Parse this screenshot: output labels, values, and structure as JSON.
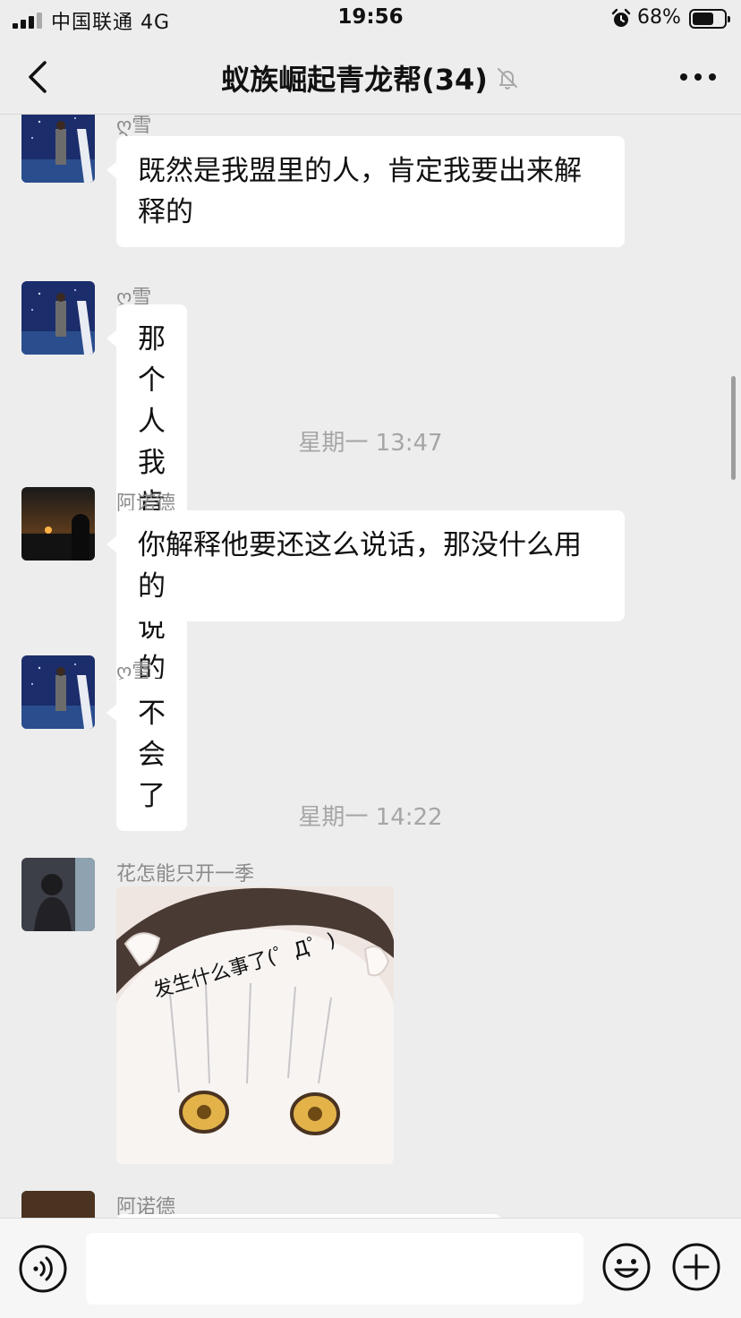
{
  "status_bar": {
    "carrier": "中国联通  4G",
    "time": "19:56",
    "battery_percent": "68%",
    "battery_level": 0.68
  },
  "nav": {
    "title": "蚁族崛起青龙帮(34)",
    "icons": {
      "back": "chevron-left-icon",
      "mute": "bell-muted-icon",
      "more": "more-dots-icon"
    }
  },
  "messages": [
    {
      "type": "text",
      "sender": "ღ雪",
      "text": "既然是我盟里的人，肯定我要出来解释的"
    },
    {
      "type": "text",
      "sender": "ღ雪",
      "text": "那个人我肯定会说的"
    },
    {
      "type": "time",
      "text": "星期一 13:47"
    },
    {
      "type": "text",
      "sender": "阿诺德",
      "text": "你解释他要还这么说话，那没什么用的"
    },
    {
      "type": "text",
      "sender": "ღ雪",
      "text": "不会了"
    },
    {
      "type": "time",
      "text": "星期一 14:22"
    },
    {
      "type": "sticker",
      "sender": "花怎能只开一季",
      "sticker_text": "发生什么事了(゜Д゜)"
    },
    {
      "type": "partial",
      "sender": "阿诺德"
    }
  ],
  "input_bar": {
    "placeholder": "",
    "icons": {
      "voice": "voice-icon",
      "emoji": "emoji-icon",
      "plus": "plus-icon"
    }
  },
  "colors": {
    "background": "#ededed",
    "bubble": "#ffffff",
    "sender_text": "#8a8a8a",
    "timestamp_text": "#a6a6a6"
  }
}
